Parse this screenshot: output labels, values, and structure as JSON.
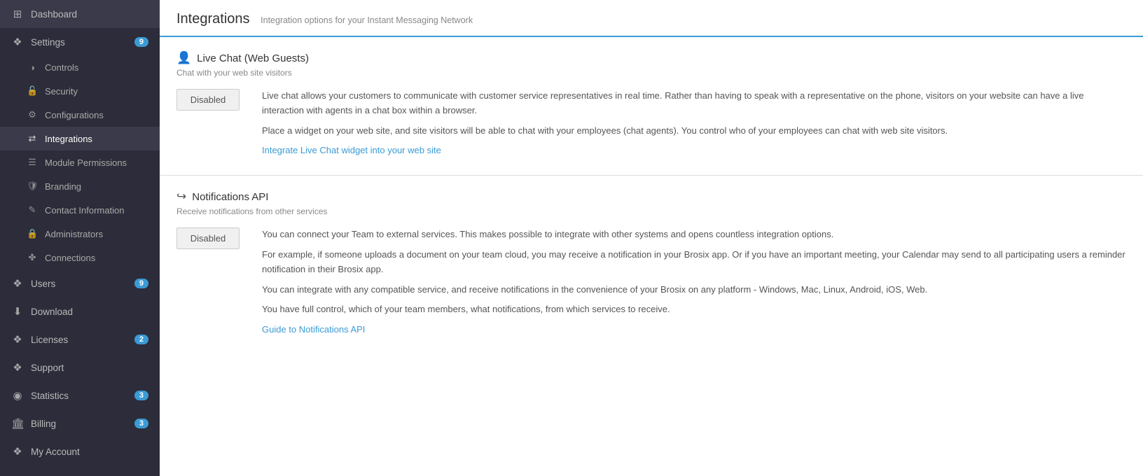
{
  "sidebar": {
    "items": [
      {
        "id": "dashboard",
        "label": "Dashboard",
        "icon": "⊞",
        "badge": null,
        "active": false
      },
      {
        "id": "settings",
        "label": "Settings",
        "icon": "✦",
        "badge": "9",
        "active": false
      },
      {
        "id": "controls",
        "label": "Controls",
        "icon": "◑",
        "badge": null,
        "active": false,
        "sub": true
      },
      {
        "id": "security",
        "label": "Security",
        "icon": "🔒",
        "badge": null,
        "active": false,
        "sub": true
      },
      {
        "id": "configurations",
        "label": "Configurations",
        "icon": "⚙",
        "badge": null,
        "active": false,
        "sub": true
      },
      {
        "id": "integrations",
        "label": "Integrations",
        "icon": "⇄",
        "badge": null,
        "active": true,
        "sub": true
      },
      {
        "id": "module-permissions",
        "label": "Module Permissions",
        "icon": "☰",
        "badge": null,
        "active": false,
        "sub": true
      },
      {
        "id": "branding",
        "label": "Branding",
        "icon": "🛡",
        "badge": null,
        "active": false,
        "sub": true
      },
      {
        "id": "contact-information",
        "label": "Contact Information",
        "icon": "✎",
        "badge": null,
        "active": false,
        "sub": true
      },
      {
        "id": "administrators",
        "label": "Administrators",
        "icon": "🔒",
        "badge": null,
        "active": false,
        "sub": true
      },
      {
        "id": "connections",
        "label": "Connections",
        "icon": "✤",
        "badge": null,
        "active": false,
        "sub": true
      },
      {
        "id": "users",
        "label": "Users",
        "icon": "✦",
        "badge": "9",
        "active": false
      },
      {
        "id": "download",
        "label": "Download",
        "icon": "⬇",
        "badge": null,
        "active": false
      },
      {
        "id": "licenses",
        "label": "Licenses",
        "icon": "✦",
        "badge": "2",
        "active": false
      },
      {
        "id": "support",
        "label": "Support",
        "icon": "✦",
        "badge": null,
        "active": false
      },
      {
        "id": "statistics",
        "label": "Statistics",
        "icon": "◉",
        "badge": "3",
        "active": false
      },
      {
        "id": "billing",
        "label": "Billing",
        "icon": "🏛",
        "badge": "3",
        "active": false
      },
      {
        "id": "my-account",
        "label": "My Account",
        "icon": "✦",
        "badge": null,
        "active": false
      }
    ]
  },
  "page": {
    "title": "Integrations",
    "subtitle": "Integration options for your Instant Messaging Network"
  },
  "sections": [
    {
      "id": "live-chat",
      "icon": "👤",
      "title": "Live Chat (Web Guests)",
      "subtitle": "Chat with your web site visitors",
      "button_label": "Disabled",
      "paragraphs": [
        "Live chat allows your customers to communicate with customer service representatives in real time. Rather than having to speak with a representative on the phone, visitors on your website can have a live interaction with agents in a chat box within a browser.",
        "Place a widget on your web site, and site visitors will be able to chat with your employees (chat agents). You control who of your employees can chat with web site visitors."
      ],
      "link_text": "Integrate Live Chat widget into your web site",
      "link_href": "#"
    },
    {
      "id": "notifications-api",
      "icon": "↪",
      "title": "Notifications API",
      "subtitle": "Receive notifications from other services",
      "button_label": "Disabled",
      "paragraphs": [
        "You can connect your Team to external services. This makes possible to integrate with other systems and opens countless integration options.",
        "For example, if someone uploads a document on your team cloud, you may receive a notification in your Brosix app. Or if you have an important meeting, your Calendar may send to all participating users a reminder notification in their Brosix app.",
        "You can integrate with any compatible service, and receive notifications in the convenience of your Brosix on any platform - Windows, Mac, Linux, Android, iOS, Web.",
        "You have full control, which of your team members, what notifications, from which services to receive."
      ],
      "link_text": "Guide to Notifications API",
      "link_href": "#"
    }
  ]
}
